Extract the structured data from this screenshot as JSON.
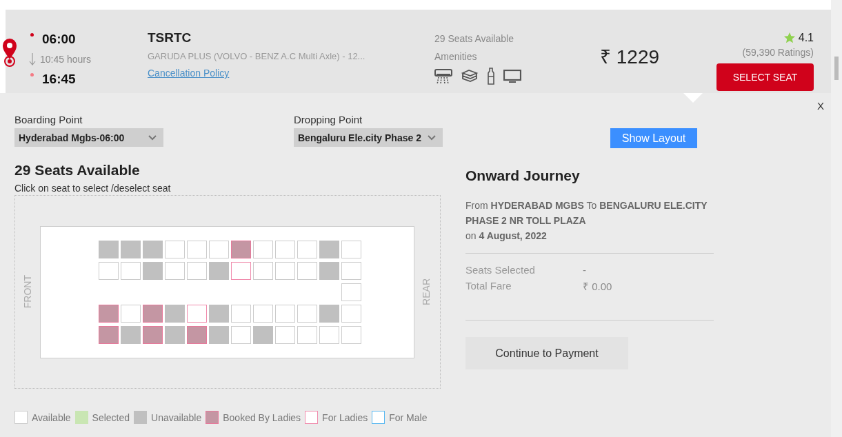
{
  "trip": {
    "departure": "06:00",
    "duration": "10:45 hours",
    "arrival": "16:45",
    "operator": "TSRTC",
    "bus_type": "GARUDA PLUS (VOLVO - BENZ A.C Multi Axle) - 12...",
    "cancellation_link": "Cancellation Policy",
    "seats_available": "29 Seats Available",
    "amenities_label": "Amenities",
    "price": "₹ 1229",
    "rating": "4.1",
    "ratings_count": "(59,390 Ratings)",
    "select_button": "SELECT SEAT"
  },
  "close": "X",
  "boarding": {
    "label": "Boarding Point",
    "value": "Hyderabad Mgbs-06:00"
  },
  "dropping": {
    "label": "Dropping Point",
    "value": "Bengaluru Ele.city Phase 2"
  },
  "show_layout": "Show Layout",
  "seat_map": {
    "title": "29 Seats Available",
    "hint": "Click on seat to select /deselect seat",
    "front": "FRONT",
    "rear": "REAR",
    "rows": [
      {
        "seats": [
          {
            "kind": "unavailable"
          },
          {
            "kind": "unavailable"
          },
          {
            "kind": "unavailable"
          },
          {
            "kind": "available"
          },
          {
            "kind": "available"
          },
          {
            "kind": "available"
          },
          {
            "kind": "booked_ladies"
          },
          {
            "kind": "available"
          },
          {
            "kind": "available"
          },
          {
            "kind": "available"
          },
          {
            "kind": "unavailable"
          },
          {
            "kind": "available"
          }
        ]
      },
      {
        "seats": [
          {
            "kind": "available"
          },
          {
            "kind": "available"
          },
          {
            "kind": "unavailable"
          },
          {
            "kind": "available"
          },
          {
            "kind": "available"
          },
          {
            "kind": "unavailable"
          },
          {
            "kind": "ladies"
          },
          {
            "kind": "available"
          },
          {
            "kind": "available"
          },
          {
            "kind": "available"
          },
          {
            "kind": "unavailable"
          },
          {
            "kind": "available"
          }
        ]
      },
      {
        "seats": [
          {
            "kind": "gap"
          },
          {
            "kind": "gap"
          },
          {
            "kind": "gap"
          },
          {
            "kind": "gap"
          },
          {
            "kind": "gap"
          },
          {
            "kind": "gap"
          },
          {
            "kind": "gap"
          },
          {
            "kind": "gap"
          },
          {
            "kind": "gap"
          },
          {
            "kind": "gap"
          },
          {
            "kind": "gap"
          },
          {
            "kind": "available"
          }
        ]
      },
      {
        "seats": [
          {
            "kind": "booked_ladies"
          },
          {
            "kind": "available"
          },
          {
            "kind": "booked_ladies"
          },
          {
            "kind": "unavailable"
          },
          {
            "kind": "ladies"
          },
          {
            "kind": "unavailable"
          },
          {
            "kind": "available"
          },
          {
            "kind": "available"
          },
          {
            "kind": "available"
          },
          {
            "kind": "available"
          },
          {
            "kind": "unavailable"
          },
          {
            "kind": "available"
          }
        ]
      },
      {
        "seats": [
          {
            "kind": "booked_ladies"
          },
          {
            "kind": "unavailable"
          },
          {
            "kind": "booked_ladies"
          },
          {
            "kind": "unavailable"
          },
          {
            "kind": "booked_ladies"
          },
          {
            "kind": "unavailable"
          },
          {
            "kind": "available"
          },
          {
            "kind": "unavailable"
          },
          {
            "kind": "available"
          },
          {
            "kind": "available"
          },
          {
            "kind": "available"
          },
          {
            "kind": "available"
          }
        ]
      }
    ]
  },
  "journey": {
    "title": "Onward Journey",
    "route": "From **HYDERABAD MGBS** To **BENGALURU ELE.CITY PHASE 2 NR TOLL PLAZA**",
    "date": "on **4 August, 2022**",
    "summary": [
      {
        "label": "Seats Selected",
        "value": "-"
      },
      {
        "label": "Total Fare",
        "value": "₹ 0.00"
      }
    ],
    "continue": "Continue to Payment"
  },
  "legend": [
    {
      "label": "Available",
      "kind": "available"
    },
    {
      "label": "Selected",
      "kind": "selected"
    },
    {
      "label": "Unavailable",
      "kind": "unavailable"
    },
    {
      "label": "Booked By Ladies",
      "kind": "booked_ladies"
    },
    {
      "label": "For Ladies",
      "kind": "ladies"
    },
    {
      "label": "For Male",
      "kind": "male"
    }
  ]
}
